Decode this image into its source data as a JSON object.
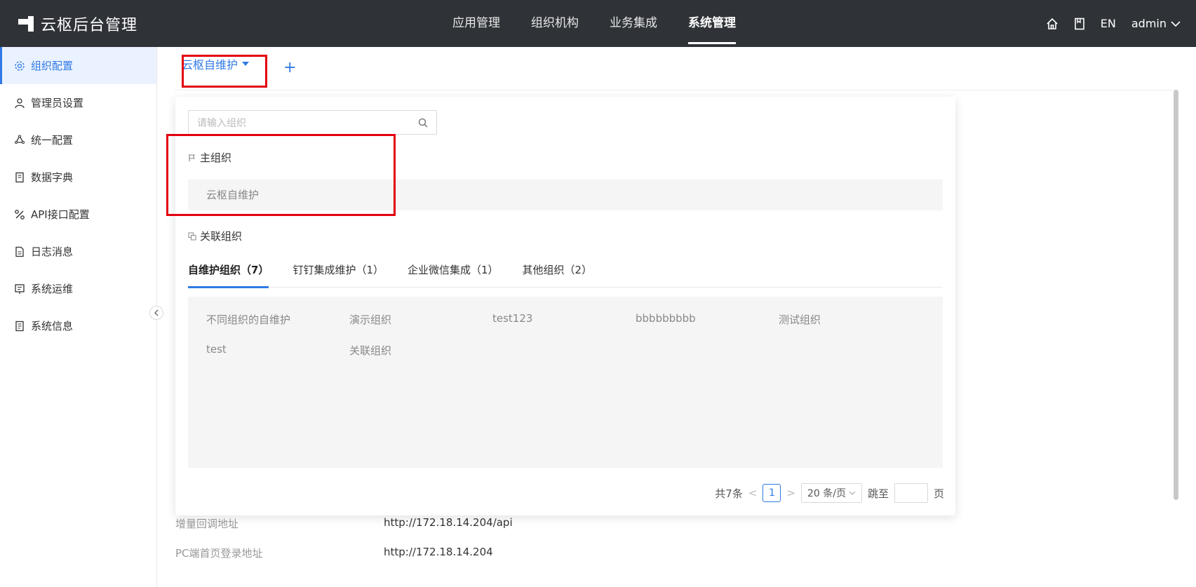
{
  "app": {
    "title": "云枢后台管理"
  },
  "topnav": [
    "应用管理",
    "组织机构",
    "业务集成",
    "系统管理"
  ],
  "topnav_active": "系统管理",
  "topright": {
    "lang": "EN",
    "user": "admin"
  },
  "sidebar": {
    "items": [
      {
        "label": "组织配置",
        "icon": "gear-icon"
      },
      {
        "label": "管理员设置",
        "icon": "user-icon"
      },
      {
        "label": "统一配置",
        "icon": "cycle-icon"
      },
      {
        "label": "数据字典",
        "icon": "book-icon"
      },
      {
        "label": "API接口配置",
        "icon": "link-icon"
      },
      {
        "label": "日志消息",
        "icon": "document-icon"
      },
      {
        "label": "系统运维",
        "icon": "tool-icon"
      },
      {
        "label": "系统信息",
        "icon": "info-icon"
      }
    ]
  },
  "org_selector": {
    "label": "云枢自维护"
  },
  "panel": {
    "search_placeholder": "请输入组织",
    "main_org_title": "主组织",
    "main_org_name": "云枢自维护",
    "related_title": "关联组织",
    "tabs": [
      "自维护组织（7）",
      "钉钉集成维护（1）",
      "企业微信集成（1）",
      "其他组织（2）"
    ],
    "orgs": [
      "不同组织的自维护",
      "演示组织",
      "test123",
      "bbbbbbbbb",
      "测试组织",
      "test",
      "关联组织"
    ],
    "pager": {
      "total": "共7条",
      "page": "1",
      "size": "20 条/页",
      "jump_label": "跳至",
      "page_unit": "页"
    }
  },
  "background_rows": [
    {
      "label": "增量回调地址",
      "value": "http://172.18.14.204/api"
    },
    {
      "label": "PC端首页登录地址",
      "value": "http://172.18.14.204"
    }
  ],
  "colors": {
    "accent": "#2f7ae5",
    "topbar": "#2f3338",
    "highlight": "#e3000f"
  }
}
